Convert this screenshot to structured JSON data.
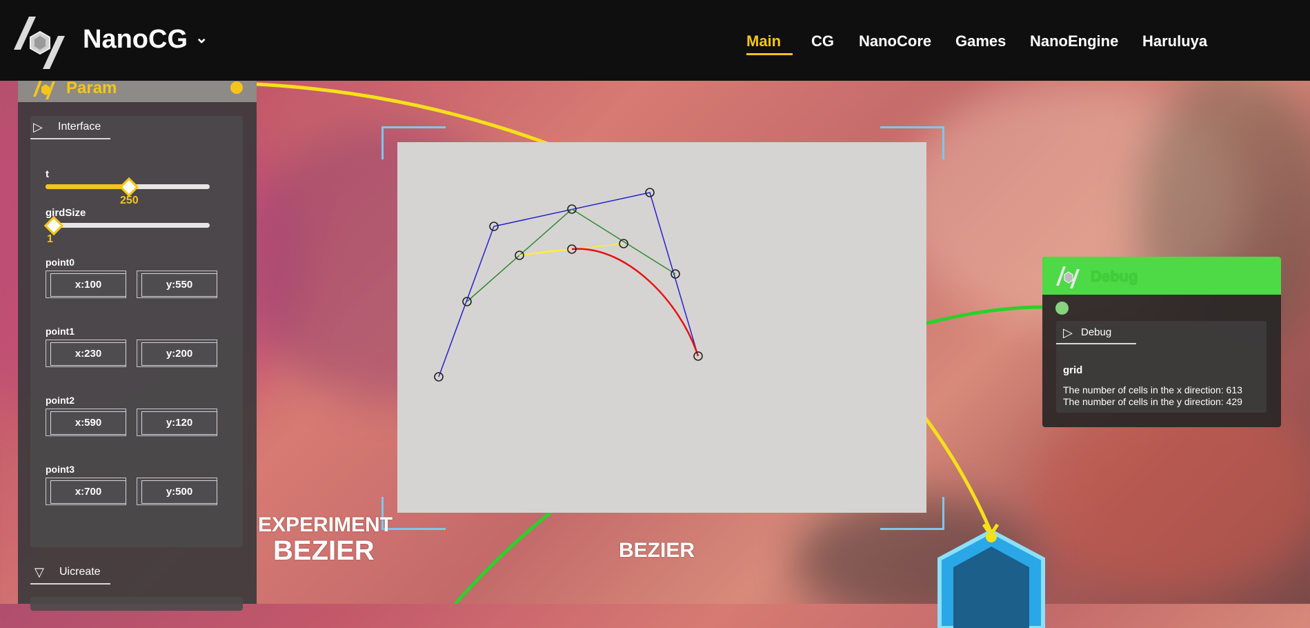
{
  "brand": {
    "name": "NanoCG",
    "chevron": "⌄"
  },
  "nav": {
    "items": [
      {
        "label": "Main",
        "active": true
      },
      {
        "label": "CG"
      },
      {
        "label": "NanoCore"
      },
      {
        "label": "Games"
      },
      {
        "label": "NanoEngine"
      },
      {
        "label": "Haruluya"
      }
    ]
  },
  "param_panel": {
    "title": "Param",
    "interface_tab": "Interface",
    "sliders": [
      {
        "label": "t",
        "value": "250",
        "fraction": 0.5
      },
      {
        "label": "girdSize",
        "value": "1",
        "fraction": 0.0
      }
    ],
    "points": [
      {
        "label": "point0",
        "x": "x:100",
        "y": "y:550"
      },
      {
        "label": "point1",
        "x": "x:230",
        "y": "y:200"
      },
      {
        "label": "point2",
        "x": "x:590",
        "y": "y:120"
      },
      {
        "label": "point3",
        "x": "x:700",
        "y": "y:500"
      }
    ],
    "uicreate_tab": "Uicreate"
  },
  "debug_panel": {
    "title": "Debug",
    "tab": "Debug",
    "section": "grid",
    "line1": "The number of cells in the x direction: 613",
    "line2": "The number of cells in the y direction: 429"
  },
  "labels": {
    "experiment": "EXPERIMENT",
    "bezier_big": "BEZIER",
    "bezier_center": "BEZIER"
  },
  "colors": {
    "accent": "#f5c518",
    "debug_green": "#4ed946",
    "control_polygon": "#2222cc",
    "level1": "#2f8a2f",
    "level2": "#ffee33",
    "curve": "#e81010"
  }
}
